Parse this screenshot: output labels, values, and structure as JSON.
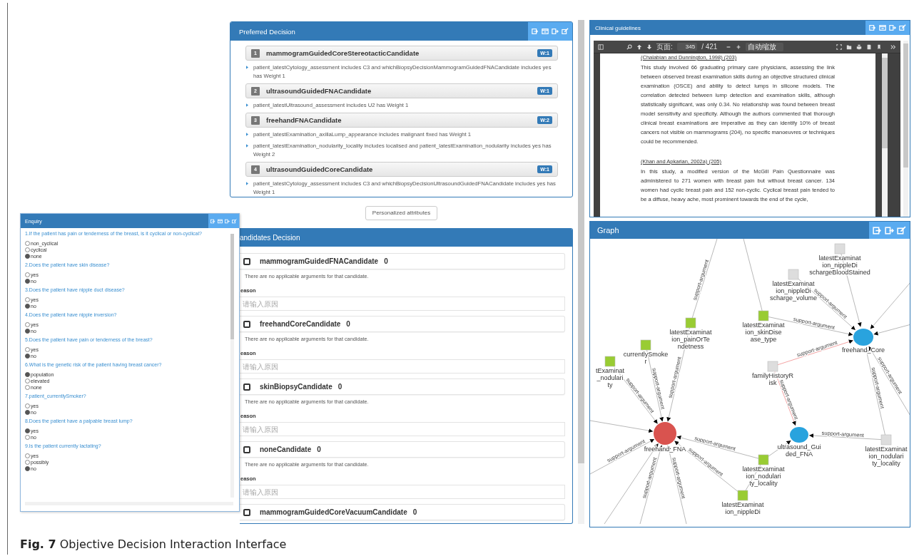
{
  "preferred_decision": {
    "title": "Preferred Decision",
    "candidates": [
      {
        "rank": "1",
        "name": "mammogramGuidedCoreStereotacticCandidate",
        "weight": "W:1",
        "arguments": [
          "patient_latestCytology_assessment includes C3 and whichBiopsyDecisionMammogramGuidedFNACandidate includes yes has Weight 1"
        ]
      },
      {
        "rank": "2",
        "name": "ultrasoundGuidedFNACandidate",
        "weight": "W:1",
        "arguments": [
          "patient_latestUltrasound_assessment includes U2 has Weight 1"
        ]
      },
      {
        "rank": "3",
        "name": "freehandFNACandidate",
        "weight": "W:2",
        "arguments": [
          "patient_latestExamination_axillaLump_appearance includes malignant fixed has Weight 1",
          "patient_latestExamination_nodularity_locality includes localised and patient_latestExamination_nodularity includes yes has Weight 2"
        ]
      },
      {
        "rank": "4",
        "name": "ultrasoundGuidedCoreCandidate",
        "weight": "W:1",
        "arguments": [
          "patient_latestCytology_assessment includes C3 and whichBiopsyDecisionUltrasoundGuidedFNACandidate includes yes has Weight 1"
        ]
      }
    ]
  },
  "personalized_button": "Personalized attributes",
  "candidates_decision": {
    "title": "andidates Decision",
    "candidates": [
      {
        "name": "mammogramGuidedFNACandidate",
        "count": "0",
        "checked": false,
        "message": "There are no applicable arguments for that candidate.",
        "reason_label": "eason",
        "reason_placeholder": "请输入原因"
      },
      {
        "name": "freehandCoreCandidate",
        "count": "0",
        "checked": false,
        "message": "There are no applicable arguments for that candidate.",
        "reason_label": "eason",
        "reason_placeholder": "请输入原因"
      },
      {
        "name": "skinBiopsyCandidate",
        "count": "0",
        "checked": false,
        "message": "There are no applicable arguments for that candidate.",
        "reason_label": "eason",
        "reason_placeholder": "请输入原因"
      },
      {
        "name": "noneCandidate",
        "count": "0",
        "checked": false,
        "message": "There are no applicable arguments for that candidate.",
        "reason_label": "eason",
        "reason_placeholder": "请输入原因"
      },
      {
        "name": "mammogramGuidedCoreVacuumCandidate",
        "count": "0",
        "checked": false
      }
    ]
  },
  "enquiry": {
    "title": "Enquiry",
    "questions": [
      {
        "text": "1.If the patient has pain or tenderness of the breast, is it cyclical or non-cyclical?",
        "options": [
          {
            "label": "non_cyclical",
            "selected": false
          },
          {
            "label": "cyclical",
            "selected": false
          },
          {
            "label": "none",
            "selected": true
          }
        ]
      },
      {
        "text": "2.Does the patient have skin disease?",
        "options": [
          {
            "label": "yes",
            "selected": false
          },
          {
            "label": "no",
            "selected": true
          }
        ]
      },
      {
        "text": "3.Does the patient have nipple duct disease?",
        "options": [
          {
            "label": "yes",
            "selected": false
          },
          {
            "label": "no",
            "selected": true
          }
        ]
      },
      {
        "text": "4.Does the patient have nipple inversion?",
        "options": [
          {
            "label": "yes",
            "selected": false
          },
          {
            "label": "no",
            "selected": true
          }
        ]
      },
      {
        "text": "5.Does the patient have pain or tenderness of the breast?",
        "options": [
          {
            "label": "yes",
            "selected": false
          },
          {
            "label": "no",
            "selected": true
          }
        ]
      },
      {
        "text": "6.What is the genetic risk of the patient having breast cancer?",
        "options": [
          {
            "label": "population",
            "selected": true
          },
          {
            "label": "elevated",
            "selected": false
          },
          {
            "label": "none",
            "selected": false
          }
        ]
      },
      {
        "text": "7.patient_currentlySmoker?",
        "options": [
          {
            "label": "yes",
            "selected": false
          },
          {
            "label": "no",
            "selected": true
          }
        ]
      },
      {
        "text": "8.Does the patient have a palpable breast lump?",
        "options": [
          {
            "label": "yes",
            "selected": true
          },
          {
            "label": "no",
            "selected": false
          }
        ]
      },
      {
        "text": "9.Is the patient currently lactating?",
        "options": [
          {
            "label": "yes",
            "selected": false
          },
          {
            "label": "possibly",
            "selected": false
          },
          {
            "label": "no",
            "selected": true
          }
        ]
      }
    ]
  },
  "clinical_guidelines": {
    "title": "Clinical guidelines",
    "viewer": {
      "page_label": "页面:",
      "page": "345",
      "page_count": "/ 421",
      "zoom": "自动缩放",
      "document": [
        {
          "kind": "link",
          "text": "(Chalabian and Dunnington, 1998) (203)"
        },
        {
          "kind": "paragraph",
          "text": "This study involved 66 graduating primary care physicians, assessing the link between observed breast examination skills during an objective structured clinical examination (OSCE) and ability to detect lumps in silicone models. The correlation detected between lump detection and examination skills, although statistically significant, was only 0.34. No relationship was found between breast model sensitivity and specificity. Although the authors commented that thorough clinical breast examinations are imperative as they can identify 10% of breast cancers not visible on mammograms (204), no specific manoeuvres or techniques could be recommended."
        },
        {
          "kind": "link",
          "text": "(Khan and Apkarian, 2002a) (205)"
        },
        {
          "kind": "paragraph",
          "text": "In this study, a modified version of the McGill Pain Questionnaire was administered to 271 women with breast pain but without breast cancer. 134 women had cyclic breast pain and 152 non-cyclic. Cyclical breast pain tended to be a diffuse, heavy ache, most prominent towards the end of the cycle,"
        }
      ]
    }
  },
  "graph": {
    "title": "Graph",
    "nodes": [
      {
        "kind": "candidate",
        "color": "#d9534f",
        "lines": [
          "freehand_FNA"
        ]
      },
      {
        "kind": "candidate",
        "color": "#29a3de",
        "lines": [
          "freehand_Core"
        ]
      },
      {
        "kind": "candidate",
        "color": "#29a3de",
        "lines": [
          "ultrasound_Gui",
          "ded_FNA"
        ]
      },
      {
        "kind": "attribute",
        "color": "#dddddd",
        "lines": [
          "familyHistoryR",
          "isk"
        ]
      },
      {
        "kind": "attribute",
        "color": "#99cc33",
        "lines": [
          "latestExaminat",
          "ion_painOrTe",
          "ndetness"
        ]
      },
      {
        "kind": "attribute",
        "color": "#99cc33",
        "lines": [
          "currentlySmoke",
          "r"
        ]
      },
      {
        "kind": "attribute",
        "color": "#99cc33",
        "lines": [
          "tExaminat",
          "_nodulari",
          "ty"
        ]
      },
      {
        "kind": "attribute",
        "color": "#99cc33",
        "lines": [
          "latestExaminat",
          "ion_skinDise",
          "ase_type"
        ]
      },
      {
        "kind": "attribute",
        "color": "#dddddd",
        "lines": [
          "latestExaminat",
          "ion_nippleDi",
          "schargeBloodStained"
        ]
      },
      {
        "kind": "attribute",
        "color": "#dddddd",
        "lines": [
          "latestExaminat",
          "ion_nippleDi",
          "scharge_volume"
        ]
      },
      {
        "kind": "attribute",
        "color": "#dddddd",
        "lines": [
          "latestExaminat",
          "ion_nodulari",
          "ty_locality"
        ]
      },
      {
        "kind": "attribute",
        "color": "#99cc33",
        "lines": [
          "latestExaminat",
          "ion_nodulari",
          "ty_locality"
        ]
      },
      {
        "kind": "attribute",
        "color": "#99cc33",
        "lines": [
          "latestExaminat",
          "ion_nippleDi"
        ]
      }
    ],
    "edges": [
      {
        "label": "support-argument",
        "highlighted": false
      },
      {
        "label": "support-argument",
        "highlighted": false
      },
      {
        "label": "support-argument",
        "highlighted": false
      },
      {
        "label": "support-argument",
        "highlighted": false
      },
      {
        "highlighted": false
      },
      {
        "label": "support-argument",
        "highlighted": false
      },
      {
        "label": "support-argument",
        "highlighted": false
      },
      {
        "label": "support-argument",
        "highlighted": false
      },
      {
        "label": "support-argument",
        "highlighted": false
      },
      {
        "label": "support-argument",
        "highlighted": false
      },
      {
        "highlighted": false
      },
      {
        "label": "support-argument",
        "highlighted": false
      },
      {
        "label": "support-argument",
        "highlighted": true
      },
      {
        "label": "support-argument",
        "highlighted": true
      },
      {
        "label": "support-argument",
        "highlighted": false
      },
      {
        "label": "support-argument",
        "highlighted": false
      },
      {
        "label": "support-argument",
        "highlighted": false
      },
      {
        "highlighted": false
      },
      {
        "highlighted": false
      },
      {
        "highlighted": false
      },
      {
        "label": "support-argument",
        "highlighted": false
      },
      {
        "highlighted": false
      },
      {
        "highlighted": false
      },
      {
        "highlighted": false
      }
    ]
  },
  "caption": "**Fig. 7** Objective Decision Interaction Interface"
}
